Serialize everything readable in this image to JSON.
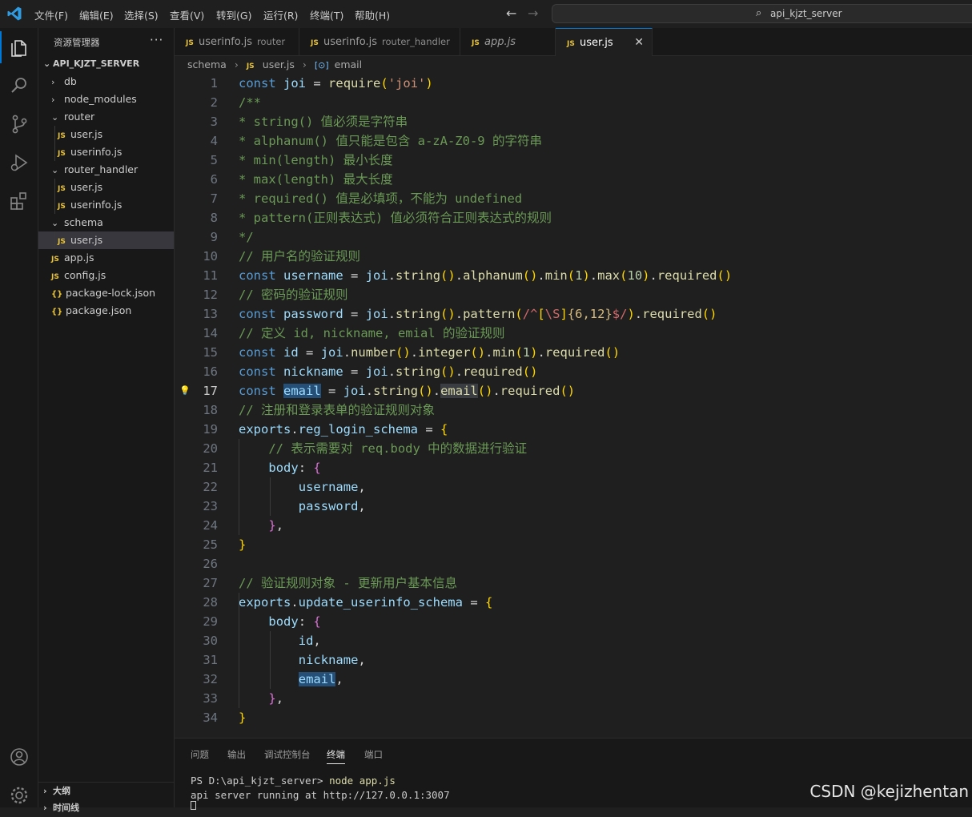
{
  "menu": [
    "文件(F)",
    "编辑(E)",
    "选择(S)",
    "查看(V)",
    "转到(G)",
    "运行(R)",
    "终端(T)",
    "帮助(H)"
  ],
  "command_center": {
    "text": "api_kjzt_server",
    "icon": "search-icon"
  },
  "nav": {
    "back": "←",
    "forward": "→"
  },
  "activity_bar": [
    "explorer-icon",
    "search-icon",
    "source-control-icon",
    "run-debug-icon",
    "extensions-icon",
    "account-icon",
    "settings-gear-icon"
  ],
  "sidebar": {
    "title": "资源管理器",
    "more": "···",
    "root": "API_KJZT_SERVER",
    "tree": [
      {
        "label": "db",
        "type": "folder",
        "expanded": false,
        "depth": 1
      },
      {
        "label": "node_modules",
        "type": "folder",
        "expanded": false,
        "depth": 1
      },
      {
        "label": "router",
        "type": "folder",
        "expanded": true,
        "depth": 1
      },
      {
        "label": "user.js",
        "type": "js",
        "depth": 2
      },
      {
        "label": "userinfo.js",
        "type": "js",
        "depth": 2
      },
      {
        "label": "router_handler",
        "type": "folder",
        "expanded": true,
        "depth": 1
      },
      {
        "label": "user.js",
        "type": "js",
        "depth": 2
      },
      {
        "label": "userinfo.js",
        "type": "js",
        "depth": 2
      },
      {
        "label": "schema",
        "type": "folder",
        "expanded": true,
        "depth": 1
      },
      {
        "label": "user.js",
        "type": "js",
        "depth": 2,
        "selected": true
      },
      {
        "label": "app.js",
        "type": "js",
        "depth": 1
      },
      {
        "label": "config.js",
        "type": "js",
        "depth": 1
      },
      {
        "label": "package-lock.json",
        "type": "json",
        "depth": 1
      },
      {
        "label": "package.json",
        "type": "json",
        "depth": 1
      }
    ],
    "outline": "大纲",
    "timeline": "时间线"
  },
  "tabs": [
    {
      "name": "userinfo.js",
      "desc": "router",
      "active": false,
      "italic": false
    },
    {
      "name": "userinfo.js",
      "desc": "router_handler",
      "active": false,
      "italic": false
    },
    {
      "name": "app.js",
      "desc": "",
      "active": false,
      "italic": true
    },
    {
      "name": "user.js",
      "desc": "",
      "active": true,
      "italic": false
    }
  ],
  "breadcrumb": {
    "folder": "schema",
    "file": "user.js",
    "symbol": "email"
  },
  "editor": {
    "current_line": 17,
    "lines": [
      "const joi = require('joi')",
      "/**",
      "* string() 值必须是字符串",
      "* alphanum() 值只能是包含 a-zA-Z0-9 的字符串",
      "* min(length) 最小长度",
      "* max(length) 最大长度",
      "* required() 值是必填项，不能为 undefined",
      "* pattern(正则表达式) 值必须符合正则表达式的规则",
      "*/",
      "// 用户名的验证规则",
      "const username = joi.string().alphanum().min(1).max(10).required()",
      "// 密码的验证规则",
      "const password = joi.string().pattern(/^[\\S]{6,12}$/).required()",
      "// 定义 id, nickname, emial 的验证规则",
      "const id = joi.number().integer().min(1).required()",
      "const nickname = joi.string().required()",
      "const email = joi.string().email().required()",
      "// 注册和登录表单的验证规则对象",
      "exports.reg_login_schema = {",
      "    // 表示需要对 req.body 中的数据进行验证",
      "    body: {",
      "        username,",
      "        password,",
      "    },",
      "}",
      "",
      "// 验证规则对象 - 更新用户基本信息",
      "exports.update_userinfo_schema = {",
      "    body: {",
      "        id,",
      "        nickname,",
      "        email,",
      "    },",
      "}"
    ]
  },
  "panel": {
    "tabs": [
      "问题",
      "输出",
      "调试控制台",
      "终端",
      "端口"
    ],
    "active_tab": "终端",
    "terminal": {
      "prompt": "PS D:\\api_kjzt_server> ",
      "command": "node app.js",
      "output": "api server running at http://127.0.0.1:3007"
    }
  },
  "watermark": "CSDN @kejizhentan",
  "colors": {
    "accent": "#0078d4",
    "js_badge": "#e8c33c",
    "keyword": "#569cd6",
    "comment": "#6a9955",
    "string": "#ce9178"
  }
}
